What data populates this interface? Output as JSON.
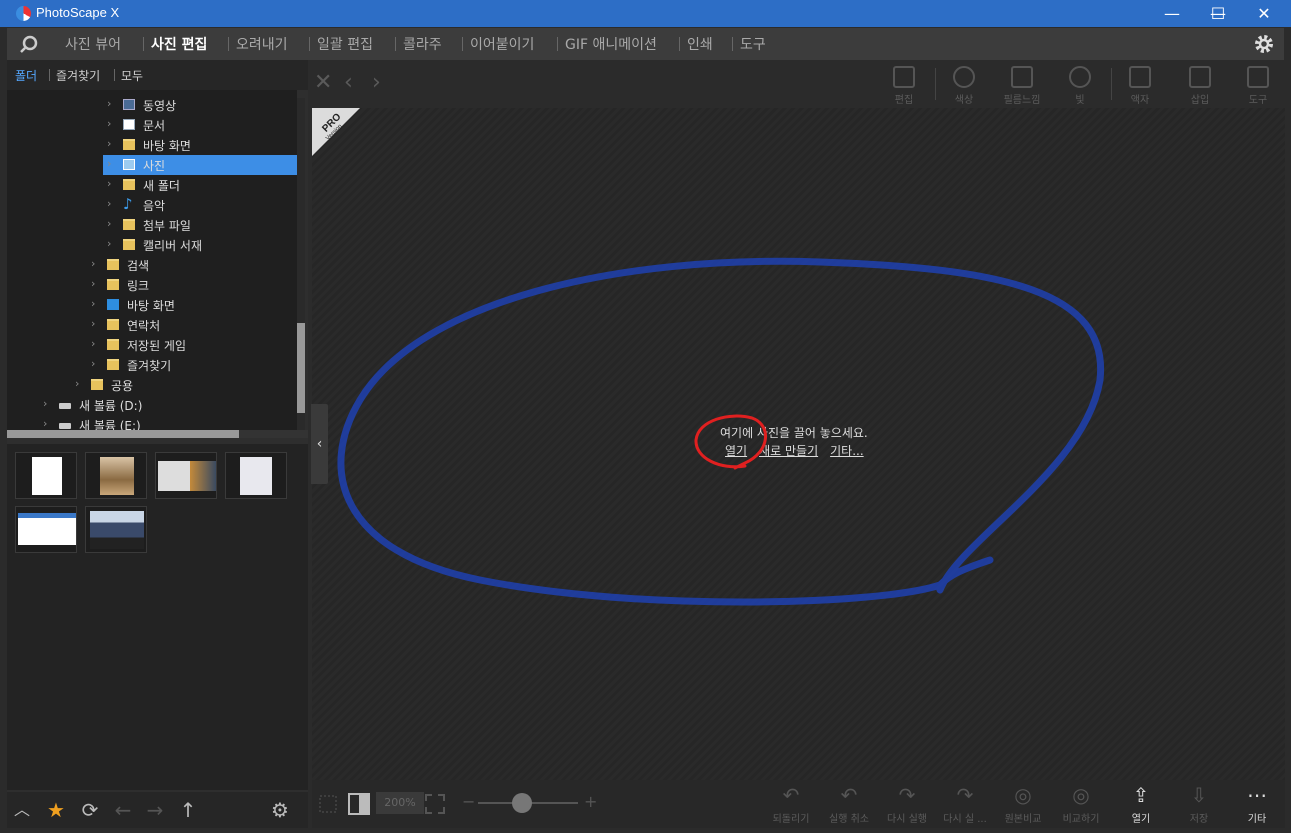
{
  "window": {
    "title": "PhotoScape X",
    "minimize": "—",
    "maximize": "☐",
    "close": "✕"
  },
  "menu": {
    "items": [
      "사진 뷰어",
      "사진 편집",
      "오려내기",
      "일괄 편집",
      "콜라주",
      "이어붙이기",
      "GIF 애니메이션",
      "인쇄",
      "도구"
    ],
    "active": 1
  },
  "left_tabs": [
    "폴더",
    "즐겨찾기",
    "모두"
  ],
  "tree": [
    {
      "label": "동영상",
      "icon": "film",
      "indent": 1
    },
    {
      "label": "문서",
      "icon": "doc",
      "indent": 1
    },
    {
      "label": "바탕 화면",
      "icon": "folder",
      "indent": 1
    },
    {
      "label": "사진",
      "icon": "pic",
      "indent": 1,
      "selected": true
    },
    {
      "label": "새 폴더",
      "icon": "folder",
      "indent": 1
    },
    {
      "label": "음악",
      "icon": "music",
      "indent": 1
    },
    {
      "label": "첨부 파일",
      "icon": "folder",
      "indent": 1
    },
    {
      "label": "캘리버 서재",
      "icon": "folder",
      "indent": 1
    },
    {
      "label": "검색",
      "icon": "folder",
      "indent": 0
    },
    {
      "label": "링크",
      "icon": "folder",
      "indent": 0
    },
    {
      "label": "바탕 화면",
      "icon": "desk",
      "indent": 0
    },
    {
      "label": "연락처",
      "icon": "folder",
      "indent": 0
    },
    {
      "label": "저장된 게임",
      "icon": "folder",
      "indent": 0
    },
    {
      "label": "즐겨찾기",
      "icon": "folder",
      "indent": 0
    },
    {
      "label": "공용",
      "icon": "folder",
      "indent": -1
    },
    {
      "label": "새 볼륨 (D:)",
      "icon": "drive",
      "indent": -2
    },
    {
      "label": "새 볼륨 (E:)",
      "icon": "drive",
      "indent": -2
    }
  ],
  "tools": [
    {
      "label": "편집",
      "icon": "edit-icon"
    },
    {
      "label": "색상",
      "icon": "color-icon"
    },
    {
      "label": "필름느낌",
      "icon": "film-effect-icon"
    },
    {
      "label": "빛",
      "icon": "light-icon"
    },
    {
      "label": "액자",
      "icon": "frame-icon"
    },
    {
      "label": "삽입",
      "icon": "insert-icon"
    },
    {
      "label": "도구",
      "icon": "tools-icon"
    }
  ],
  "pro_badge": {
    "line1": "PRO",
    "line2": "Version"
  },
  "drop_message": "여기에 사진을 끌어 놓으세요.",
  "drop_links": [
    "열기",
    "새로 만들기",
    "기타..."
  ],
  "zoom": "200%",
  "bottom_actions": [
    {
      "label": "되돌리기",
      "icon": "revert-icon",
      "enabled": false
    },
    {
      "label": "실행 취소",
      "icon": "undo-icon",
      "enabled": false
    },
    {
      "label": "다시 실행",
      "icon": "redo-icon",
      "enabled": false
    },
    {
      "label": "다시 실 ...",
      "icon": "redo-all-icon",
      "enabled": false
    },
    {
      "label": "원본비교",
      "icon": "compare-icon",
      "enabled": false
    },
    {
      "label": "비교하기",
      "icon": "compare2-icon",
      "enabled": false
    },
    {
      "label": "열기",
      "icon": "open-icon",
      "enabled": true
    },
    {
      "label": "저장",
      "icon": "save-icon",
      "enabled": false
    },
    {
      "label": "기타",
      "icon": "more-icon",
      "enabled": true
    }
  ],
  "colors": {
    "titlebar": "#2d6ec6",
    "accent": "#3d8ee6",
    "annotation_blue": "#1f3fa8",
    "annotation_red": "#e02020"
  }
}
